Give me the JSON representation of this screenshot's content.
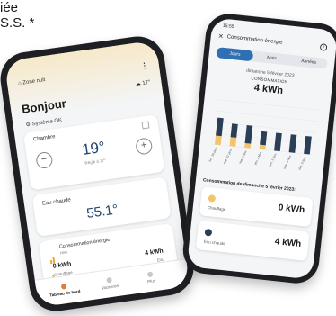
{
  "caption": {
    "line1": "iée",
    "line2": "S.S. *"
  },
  "left_phone": {
    "zone_label": "Zone nuit",
    "menu_icon": "more-vertical-icon",
    "outside_temp": "17°",
    "greeting": "Bonjour",
    "system_status": "Système OK",
    "room_card": {
      "title": "Chambre",
      "temperature": "19°",
      "subtitle": "Réglé à 17°",
      "minus": "−",
      "plus": "+"
    },
    "water_card": {
      "title": "Eau chaude",
      "value": "55.1°"
    },
    "energy_card": {
      "title": "Consommation énergie",
      "subtitle": "Hier",
      "heating_value": "0 kWh",
      "heating_label": "Chauffage",
      "water_value": "4 kWh",
      "water_label": "Eau"
    },
    "nav": {
      "item1": "Tableau de bord",
      "item2": "Vacances",
      "item3": "Plus"
    }
  },
  "right_phone": {
    "clock": "15:55",
    "title": "Consommation énergie",
    "tabs": [
      "Jours",
      "Mois",
      "Années"
    ],
    "active_tab": 0,
    "date": "dimanche 5 février 2023",
    "conso_label": "CONSOMMATION",
    "total": "4 kWh",
    "detail_title": "Consommation de dimanche 5 février 2023:",
    "heating_label": "Chauffage",
    "heating_value": "0 kWh",
    "water_label": "Eau chaude",
    "water_value": "4 kWh"
  },
  "chart_data": {
    "type": "bar",
    "categories": [
      "lun. 30 janv.",
      "mar. 31 janv.",
      "mer. 1 févr.",
      "jeu. 2 févr.",
      "ven. 3 févr.",
      "sam. 4 févr.",
      "dim. 5 févr."
    ],
    "series": [
      {
        "name": "Chauffage",
        "values": [
          2,
          2,
          1,
          1,
          0,
          0,
          0
        ],
        "color": "#f2c46b"
      },
      {
        "name": "Eau chaude",
        "values": [
          4,
          3,
          4,
          3,
          4,
          4,
          4
        ],
        "color": "#2a3f55"
      }
    ]
  },
  "colors": {
    "accent": "#2f6fb3",
    "heating": "#f2c46b",
    "water": "#2a3f55"
  }
}
